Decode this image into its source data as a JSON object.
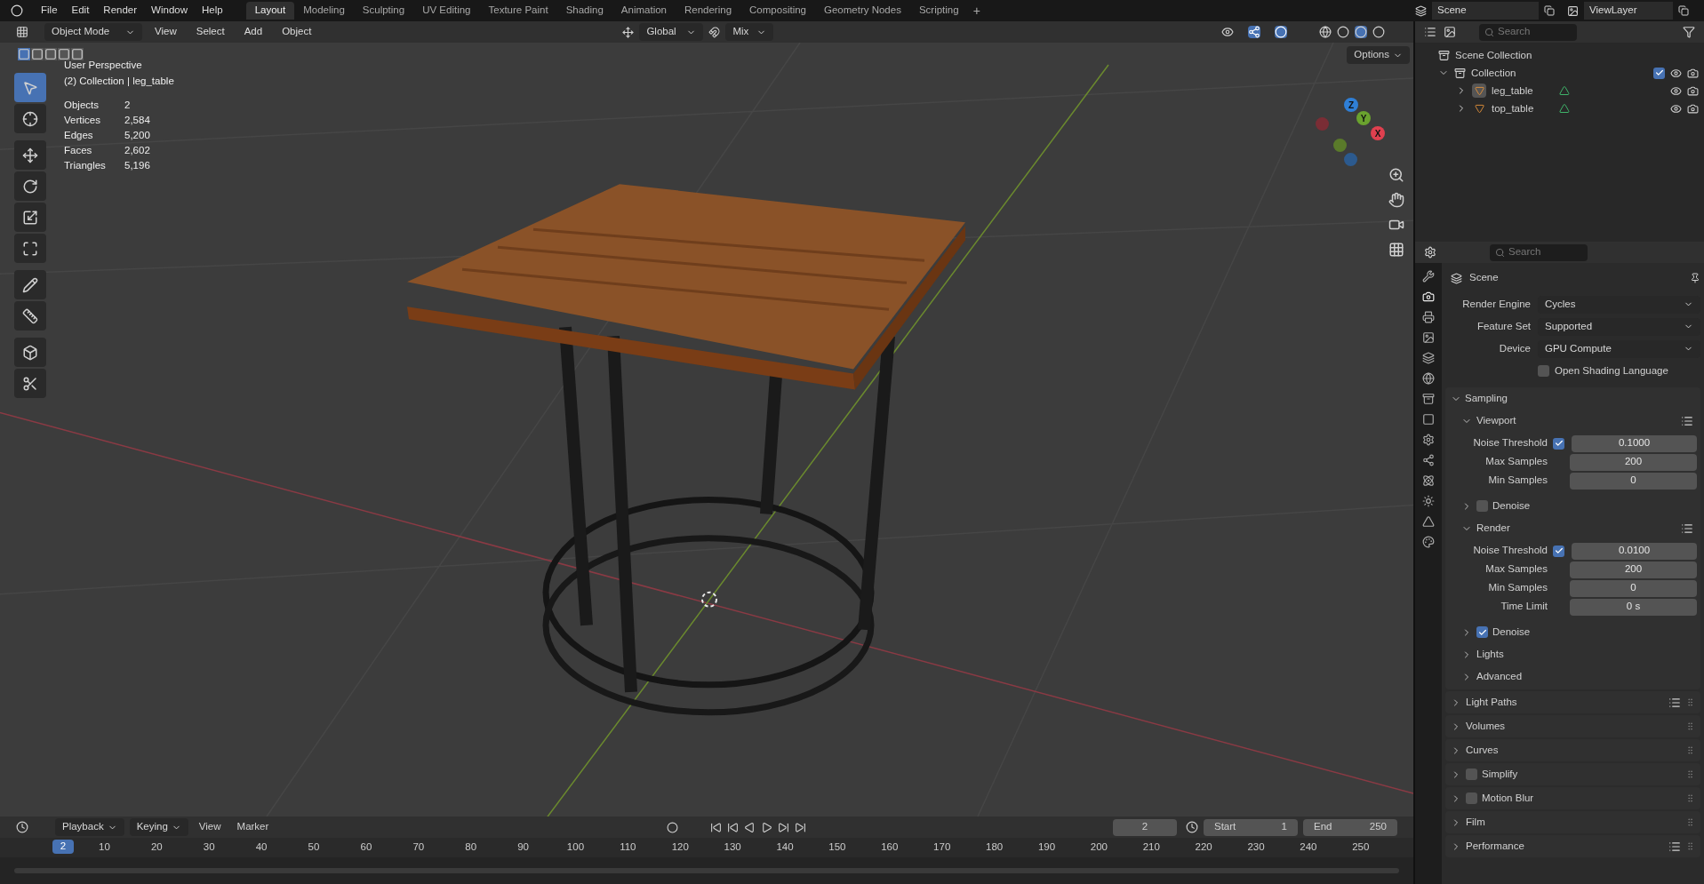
{
  "menu": [
    "File",
    "Edit",
    "Render",
    "Window",
    "Help"
  ],
  "workspaces": [
    {
      "label": "Layout",
      "selected": true
    },
    {
      "label": "Modeling",
      "selected": false
    },
    {
      "label": "Sculpting",
      "selected": false
    },
    {
      "label": "UV Editing",
      "selected": false
    },
    {
      "label": "Texture Paint",
      "selected": false
    },
    {
      "label": "Shading",
      "selected": false
    },
    {
      "label": "Animation",
      "selected": false
    },
    {
      "label": "Rendering",
      "selected": false
    },
    {
      "label": "Compositing",
      "selected": false
    },
    {
      "label": "Geometry Nodes",
      "selected": false
    },
    {
      "label": "Scripting",
      "selected": false
    }
  ],
  "add_workspace": "+",
  "scene": "Scene",
  "view_layer": "ViewLayer",
  "viewport_header": {
    "mode": "Object Mode",
    "menus": [
      "View",
      "Select",
      "Add",
      "Object"
    ],
    "orientation": "Global",
    "snap": "Mix",
    "options": "Options"
  },
  "overlay": {
    "title": "User Perspective",
    "context": "(2) Collection | leg_table",
    "stats": [
      {
        "label": "Objects",
        "value": "2"
      },
      {
        "label": "Vertices",
        "value": "2,584"
      },
      {
        "label": "Edges",
        "value": "5,200"
      },
      {
        "label": "Faces",
        "value": "2,602"
      },
      {
        "label": "Triangles",
        "value": "5,196"
      }
    ]
  },
  "gizmo": {
    "z": "Z",
    "y": "Y",
    "x": "X"
  },
  "outliner": {
    "search_placeholder": "Search",
    "root": "Scene Collection",
    "collection": {
      "name": "Collection",
      "expanded": true,
      "checked": true,
      "children": [
        {
          "name": "leg_table",
          "selected": true
        },
        {
          "name": "top_table",
          "selected": false
        }
      ]
    }
  },
  "properties": {
    "search_placeholder": "Search",
    "context": "Scene",
    "fields": [
      {
        "label": "Render Engine",
        "value": "Cycles"
      },
      {
        "label": "Feature Set",
        "value": "Supported"
      },
      {
        "label": "Device",
        "value": "GPU Compute"
      }
    ],
    "osl": {
      "label": "Open Shading Language",
      "checked": false
    },
    "sampling": {
      "title": "Sampling",
      "expanded": true,
      "items": [
        {
          "kind": "sub",
          "title": "Viewport",
          "expanded": true,
          "rows": [
            {
              "kind": "threshold",
              "label": "Noise Threshold",
              "checked": true,
              "value": "0.1000"
            },
            {
              "kind": "number",
              "label": "Max Samples",
              "value": "200"
            },
            {
              "kind": "number",
              "label": "Min Samples",
              "value": "0"
            }
          ]
        },
        {
          "kind": "check",
          "title": "Denoise",
          "expanded": false,
          "checked": false
        },
        {
          "kind": "sub",
          "title": "Render",
          "expanded": true,
          "rows": [
            {
              "kind": "threshold",
              "label": "Noise Threshold",
              "checked": true,
              "value": "0.0100"
            },
            {
              "kind": "number",
              "label": "Max Samples",
              "value": "200"
            },
            {
              "kind": "number",
              "label": "Min Samples",
              "value": "0"
            },
            {
              "kind": "number",
              "label": "Time Limit",
              "value": "0 s"
            }
          ]
        },
        {
          "kind": "check",
          "title": "Denoise",
          "expanded": false,
          "checked": true
        },
        {
          "kind": "plain",
          "title": "Lights",
          "expanded": false
        },
        {
          "kind": "plain",
          "title": "Advanced",
          "expanded": false
        }
      ]
    },
    "panels": [
      {
        "kind": "presets",
        "title": "Light Paths",
        "expanded": false
      },
      {
        "kind": "plain",
        "title": "Volumes",
        "expanded": false
      },
      {
        "kind": "plain",
        "title": "Curves",
        "expanded": false
      },
      {
        "kind": "check",
        "title": "Simplify",
        "expanded": false,
        "checked": false
      },
      {
        "kind": "check",
        "title": "Motion Blur",
        "expanded": false,
        "checked": false
      },
      {
        "kind": "plain",
        "title": "Film",
        "expanded": false
      },
      {
        "kind": "presets",
        "title": "Performance",
        "expanded": false
      }
    ]
  },
  "timeline": {
    "playhead_frame": "2",
    "menus": [
      "Playback",
      "Keying",
      "View",
      "Marker"
    ],
    "current_frame": "2",
    "start_label": "Start",
    "start": "1",
    "end_label": "End",
    "end": "250",
    "ticks": [
      "10",
      "20",
      "30",
      "40",
      "50",
      "60",
      "70",
      "80",
      "90",
      "100",
      "110",
      "120",
      "130",
      "140",
      "150",
      "160",
      "170",
      "180",
      "190",
      "200",
      "210",
      "220",
      "230",
      "240",
      "250"
    ]
  }
}
